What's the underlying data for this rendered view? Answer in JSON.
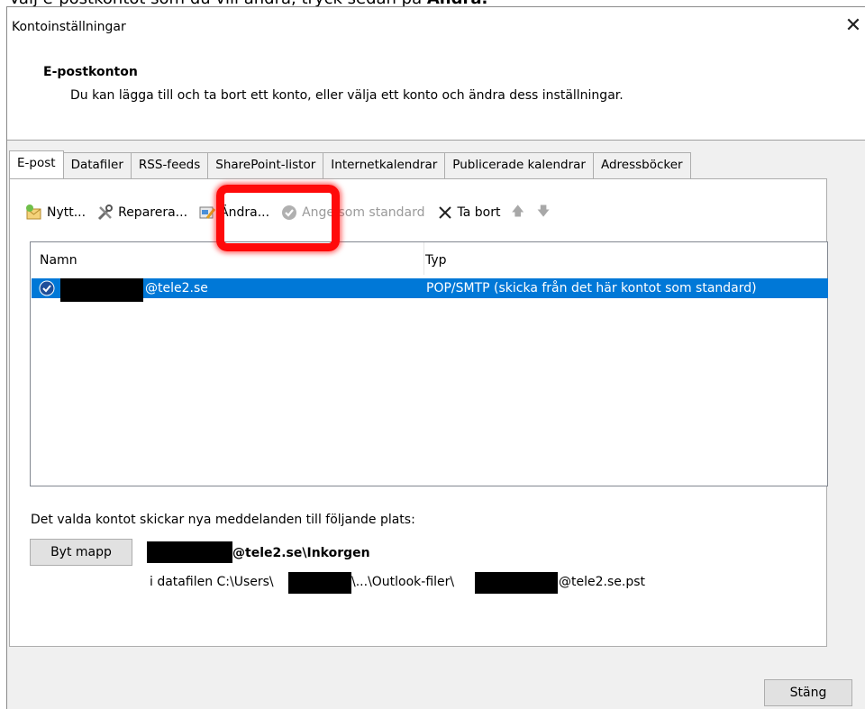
{
  "caption": {
    "text": "Välj e-postkontot som du vill ändra, tryck sedan på ",
    "bold": "Ändra."
  },
  "window": {
    "title": "Kontoinställningar",
    "close_glyph": "✕"
  },
  "header": {
    "title": "E-postkonton",
    "description": "Du kan lägga till och ta bort ett konto, eller välja ett konto och ändra dess inställningar."
  },
  "tabs": [
    {
      "label": "E-post",
      "active": true
    },
    {
      "label": "Datafiler"
    },
    {
      "label": "RSS-feeds"
    },
    {
      "label": "SharePoint-listor"
    },
    {
      "label": "Internetkalendrar"
    },
    {
      "label": "Publicerade kalendrar"
    },
    {
      "label": "Adressböcker"
    }
  ],
  "toolbar": {
    "new_label": "Nytt...",
    "repair_label": "Reparera...",
    "change_label": "Ändra...",
    "set_default_label": "Ange som standard",
    "remove_label": "Ta bort",
    "move_up_glyph": "🡅",
    "move_down_glyph": "🡇"
  },
  "list": {
    "columns": {
      "name": "Namn",
      "type": "Typ"
    },
    "rows": [
      {
        "account": "@tele2.se",
        "type": "POP/SMTP (skicka från det här kontot som standard)"
      }
    ]
  },
  "delivery": {
    "label": "Det valda kontot skickar nya meddelanden till följande plats:",
    "change_folder_label": "Byt mapp",
    "folder": "@tele2.se\\Inkorgen",
    "file_prefix": "i datafilen C:\\Users\\",
    "file_middle": "\\...\\Outlook-filer\\",
    "file_suffix": "@tele2.se.pst"
  },
  "footer": {
    "close_label": "Stäng"
  },
  "colors": {
    "selection": "#0078d7",
    "highlight": "#ff0a0a"
  }
}
